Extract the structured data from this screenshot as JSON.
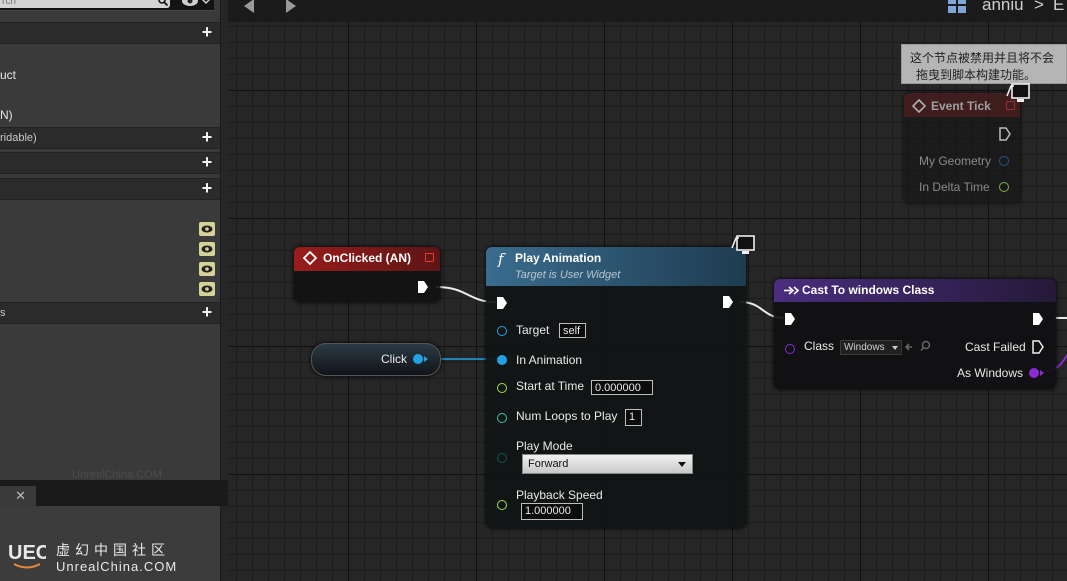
{
  "left_panel": {
    "search_placeholder": "rch",
    "list_item_1": "uct",
    "list_item_2": "N)",
    "section_overridable": "ridable)",
    "section_last": "s",
    "bottom_watermark": "UnrealChina.COM",
    "tab_close": "✕",
    "logo_cn": "虚幻中国社区",
    "logo_en": "UnrealChina.COM"
  },
  "toolbar": {
    "breadcrumb_item": "anniu",
    "breadcrumb_sep": ">",
    "breadcrumb_next": "E"
  },
  "tooltip": {
    "line1": "这个节点被禁用并且将不会",
    "line2": "拖曳到脚本构建功能。"
  },
  "nodes": {
    "event_tick": {
      "title": "Event Tick",
      "pin_geometry": "My Geometry",
      "pin_delta": "In Delta Time"
    },
    "onclicked": {
      "title": "OnClicked (AN)"
    },
    "click_var": {
      "label": "Click"
    },
    "play_animation": {
      "title": "Play Animation",
      "subtitle": "Target is User Widget",
      "pin_target": "Target",
      "target_value": "self",
      "pin_in_animation": "In Animation",
      "pin_start_time": "Start at Time",
      "start_time_value": "0.000000",
      "pin_num_loops": "Num Loops to Play",
      "num_loops_value": "1",
      "pin_play_mode": "Play Mode",
      "play_mode_value": "Forward",
      "pin_playback_speed": "Playback Speed",
      "playback_speed_value": "1.000000"
    },
    "cast": {
      "title": "Cast To windows Class",
      "pin_class": "Class",
      "class_value": "Windows",
      "pin_cast_failed": "Cast Failed",
      "pin_as_windows": "As Windows"
    }
  },
  "colors": {
    "event_header": "#8b1f1f",
    "function_header": "#2e5a78",
    "cast_header": "#3a2660",
    "exec_pin": "#ffffff",
    "object_pin": "#1fa3e6",
    "float_pin": "#9be04f",
    "int_pin": "#3ec49a",
    "enum_pin": "#0f5a4a",
    "class_pin": "#8a2bd4",
    "struct_pin": "#2266aa"
  },
  "icons": {
    "search": "search-icon",
    "view_options": "eye-icon",
    "back": "arrow-left-icon",
    "forward": "arrow-right-icon",
    "graph": "graph-icon",
    "function": "function-icon",
    "event": "event-diamond-icon",
    "cast": "cast-icon",
    "latent": "clock-icon"
  }
}
